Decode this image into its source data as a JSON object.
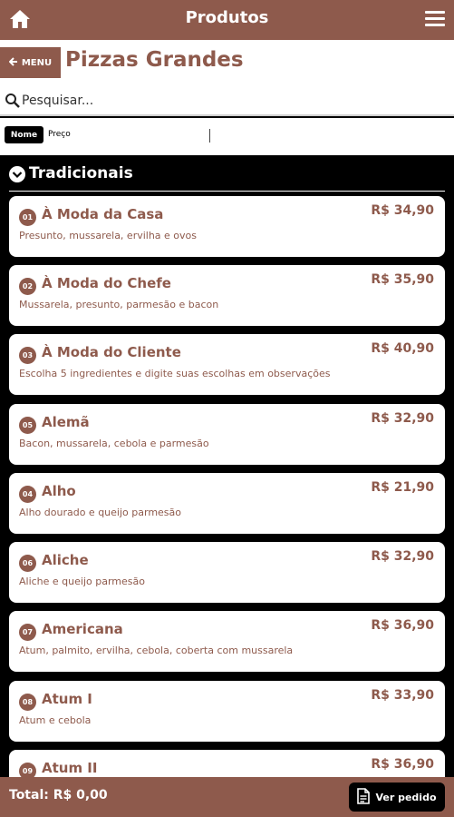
{
  "header": {
    "title": "Produtos"
  },
  "subheader": {
    "back_label": "MENU",
    "page_title": "Pizzas Grandes"
  },
  "search": {
    "placeholder": "Pesquisar..."
  },
  "sort": {
    "name_label": "Nome",
    "price_label": "Preço"
  },
  "section": {
    "title": "Tradicionais"
  },
  "products": [
    {
      "num": "01",
      "name": "À Moda da Casa",
      "price": "R$ 34,90",
      "desc": "Presunto, mussarela, ervilha e ovos"
    },
    {
      "num": "02",
      "name": "À Moda do Chefe",
      "price": "R$ 35,90",
      "desc": "Mussarela, presunto, parmesão e bacon"
    },
    {
      "num": "03",
      "name": "À Moda do Cliente",
      "price": "R$ 40,90",
      "desc": "Escolha 5 ingredientes e digite suas escolhas em observações"
    },
    {
      "num": "05",
      "name": "Alemã",
      "price": "R$ 32,90",
      "desc": "Bacon, mussarela, cebola e parmesão"
    },
    {
      "num": "04",
      "name": "Alho",
      "price": "R$ 21,90",
      "desc": "Alho dourado e queijo parmesão"
    },
    {
      "num": "06",
      "name": "Aliche",
      "price": "R$ 32,90",
      "desc": "Aliche e queijo parmesão"
    },
    {
      "num": "07",
      "name": "Americana",
      "price": "R$ 36,90",
      "desc": "Atum, palmito, ervilha, cebola, coberta com mussarela"
    },
    {
      "num": "08",
      "name": "Atum I",
      "price": "R$ 33,90",
      "desc": "Atum e cebola"
    },
    {
      "num": "09",
      "name": "Atum II",
      "price": "R$ 36,90",
      "desc": ""
    }
  ],
  "footer": {
    "total": "Total: R$ 0,00",
    "order_label": "Ver pedido"
  }
}
